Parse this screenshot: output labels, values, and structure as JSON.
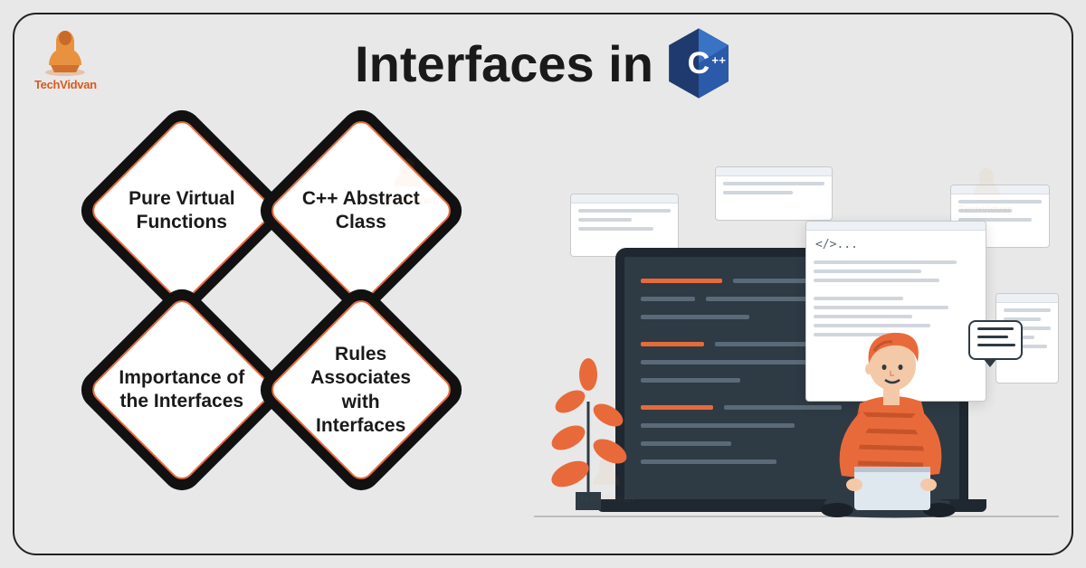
{
  "brand": {
    "name": "TechVidvan"
  },
  "title": {
    "text": "Interfaces in",
    "badge_letter": "C",
    "badge_plus": "++"
  },
  "cards": {
    "tl": "Pure Virtual Functions",
    "tr": "C++ Abstract Class",
    "bl": "Importance of the Interfaces",
    "br": "Rules Associates with Interfaces"
  },
  "illustration": {
    "code_tag": "</>..."
  }
}
